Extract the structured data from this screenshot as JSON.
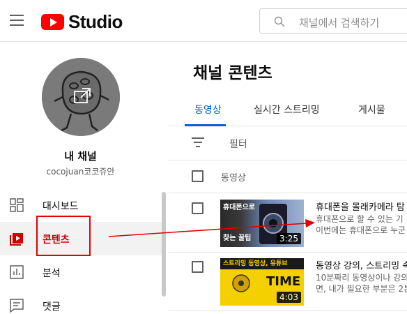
{
  "header": {
    "logo_text": "Studio",
    "search_placeholder": "채널에서 검색하기"
  },
  "sidebar": {
    "channel_title": "내 채널",
    "channel_handle": "cocojuan코코쥬안",
    "items": [
      {
        "label": "대시보드",
        "icon": "dashboard-icon"
      },
      {
        "label": "콘텐츠",
        "icon": "content-icon"
      },
      {
        "label": "분석",
        "icon": "analytics-icon"
      },
      {
        "label": "댓글",
        "icon": "comments-icon"
      }
    ]
  },
  "main": {
    "title": "채널 콘텐츠",
    "tabs": [
      {
        "label": "동영상"
      },
      {
        "label": "실시간 스트리밍"
      },
      {
        "label": "게시물"
      }
    ],
    "filter_label": "필터",
    "column_header": "동영상",
    "videos": [
      {
        "title": "휴대폰을 몰래카메라 탐",
        "desc_line1": "휴대폰으로 할 수 있는 기",
        "desc_line2": "이번에는 휴대폰으로 누군",
        "duration": "3:25",
        "thumb_text_1": "휴대폰으로",
        "thumb_text_2": "찾는 꿀팁"
      },
      {
        "title": "동영상 강의, 스트리밍 속",
        "desc_line1": "10분짜리 동영상이나 강의",
        "desc_line2": "면, 내가 필요한 부분은 2분",
        "duration": "4:03",
        "thumb_text_1": "스트리밍 동영상, 유튜브",
        "thumb_text_2": "TIME"
      }
    ]
  },
  "colors": {
    "brand_red": "#ff0000",
    "accent_blue": "#065fd4",
    "annotation_red": "#e00000"
  }
}
